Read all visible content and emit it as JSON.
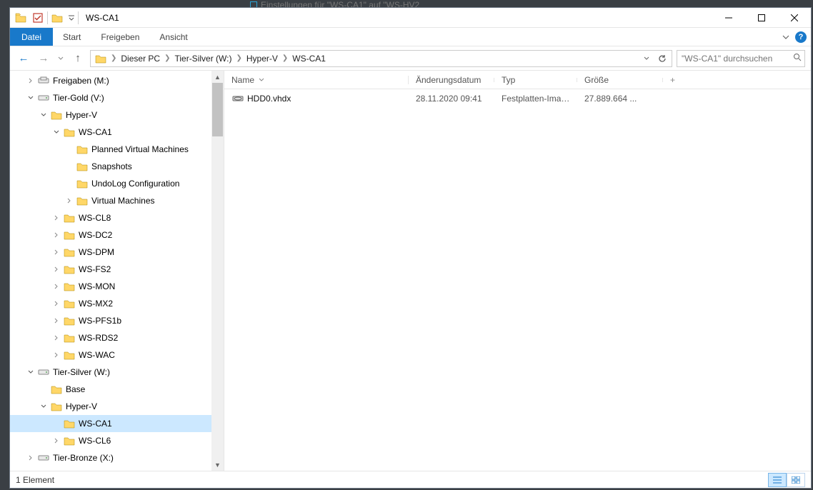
{
  "background_tab": "Einstellungen für \"WS-CA1\" auf \"WS-HV2",
  "window": {
    "title": "WS-CA1"
  },
  "ribbon": {
    "file": "Datei",
    "tabs": [
      "Start",
      "Freigeben",
      "Ansicht"
    ]
  },
  "breadcrumbs": [
    "Dieser PC",
    "Tier-Silver (W:)",
    "Hyper-V",
    "WS-CA1"
  ],
  "search_placeholder": "\"WS-CA1\" durchsuchen",
  "tree": {
    "selected_path": "W:/Hyper-V/WS-CA1",
    "items": [
      {
        "indent": 1,
        "twist": "closed",
        "icon": "share",
        "label": "Freigaben (M:)"
      },
      {
        "indent": 1,
        "twist": "open",
        "icon": "drive",
        "label": "Tier-Gold (V:)"
      },
      {
        "indent": 2,
        "twist": "open",
        "icon": "folder",
        "label": "Hyper-V"
      },
      {
        "indent": 3,
        "twist": "open",
        "icon": "folder",
        "label": "WS-CA1"
      },
      {
        "indent": 4,
        "twist": "none",
        "icon": "folder",
        "label": "Planned Virtual Machines"
      },
      {
        "indent": 4,
        "twist": "none",
        "icon": "folder",
        "label": "Snapshots"
      },
      {
        "indent": 4,
        "twist": "none",
        "icon": "folder",
        "label": "UndoLog Configuration"
      },
      {
        "indent": 4,
        "twist": "closed",
        "icon": "folder",
        "label": "Virtual Machines"
      },
      {
        "indent": 3,
        "twist": "closed",
        "icon": "folder",
        "label": "WS-CL8"
      },
      {
        "indent": 3,
        "twist": "closed",
        "icon": "folder",
        "label": "WS-DC2"
      },
      {
        "indent": 3,
        "twist": "closed",
        "icon": "folder",
        "label": "WS-DPM"
      },
      {
        "indent": 3,
        "twist": "closed",
        "icon": "folder",
        "label": "WS-FS2"
      },
      {
        "indent": 3,
        "twist": "closed",
        "icon": "folder",
        "label": "WS-MON"
      },
      {
        "indent": 3,
        "twist": "closed",
        "icon": "folder",
        "label": "WS-MX2"
      },
      {
        "indent": 3,
        "twist": "closed",
        "icon": "folder",
        "label": "WS-PFS1b"
      },
      {
        "indent": 3,
        "twist": "closed",
        "icon": "folder",
        "label": "WS-RDS2"
      },
      {
        "indent": 3,
        "twist": "closed",
        "icon": "folder",
        "label": "WS-WAC"
      },
      {
        "indent": 1,
        "twist": "open",
        "icon": "drive",
        "label": "Tier-Silver (W:)"
      },
      {
        "indent": 2,
        "twist": "none",
        "icon": "folder",
        "label": "Base"
      },
      {
        "indent": 2,
        "twist": "open",
        "icon": "folder",
        "label": "Hyper-V"
      },
      {
        "indent": 3,
        "twist": "none",
        "icon": "folder",
        "label": "WS-CA1",
        "selected": true
      },
      {
        "indent": 3,
        "twist": "closed",
        "icon": "folder",
        "label": "WS-CL6"
      },
      {
        "indent": 1,
        "twist": "closed",
        "icon": "drive",
        "label": "Tier-Bronze (X:)"
      }
    ]
  },
  "list": {
    "columns": {
      "name": "Name",
      "date": "Änderungsdatum",
      "type": "Typ",
      "size": "Größe"
    },
    "items": [
      {
        "icon": "vhdx",
        "name": "HDD0.vhdx",
        "date": "28.11.2020 09:41",
        "type": "Festplatten-Image...",
        "size": "27.889.664 ..."
      }
    ]
  },
  "status": {
    "text": "1 Element"
  }
}
